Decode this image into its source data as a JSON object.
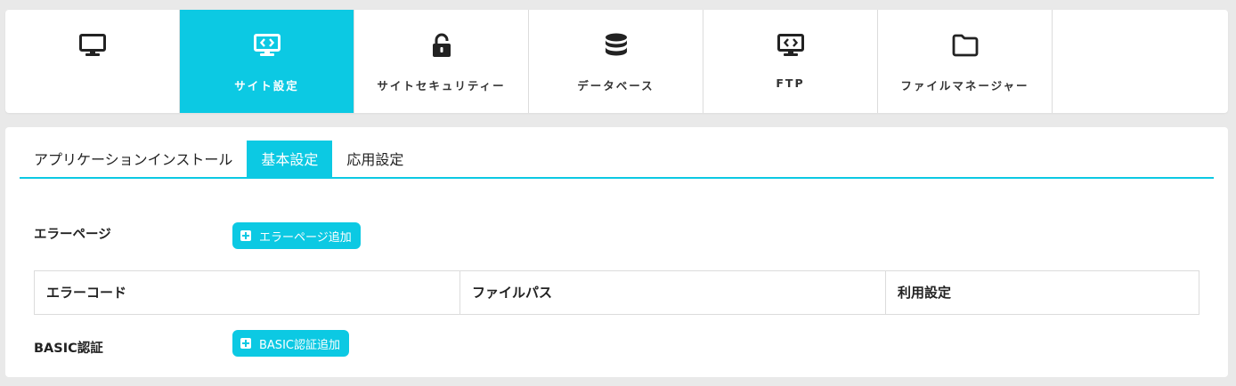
{
  "nav": {
    "items": [
      {
        "icon": "monitor-icon",
        "label": ""
      },
      {
        "icon": "code-monitor-icon",
        "label": "サイト設定"
      },
      {
        "icon": "unlock-icon",
        "label": "サイトセキュリティー"
      },
      {
        "icon": "database-icon",
        "label": "データベース"
      },
      {
        "icon": "code-monitor-icon",
        "label": "FTP"
      },
      {
        "icon": "folder-icon",
        "label": "ファイルマネージャー"
      }
    ],
    "active_index": 1
  },
  "tabs": [
    {
      "label": "アプリケーションインストール"
    },
    {
      "label": "基本設定"
    },
    {
      "label": "応用設定"
    }
  ],
  "active_tab": 1,
  "error_page": {
    "label": "エラーページ",
    "add_button": "エラーページ追加",
    "columns": [
      "エラーコード",
      "ファイルパス",
      "利用設定"
    ]
  },
  "basic_auth": {
    "label": "BASIC認証",
    "add_button": "BASIC認証追加"
  },
  "colors": {
    "accent": "#0cc9e3",
    "border": "#dcdcdc",
    "background": "#e9e9e9"
  }
}
